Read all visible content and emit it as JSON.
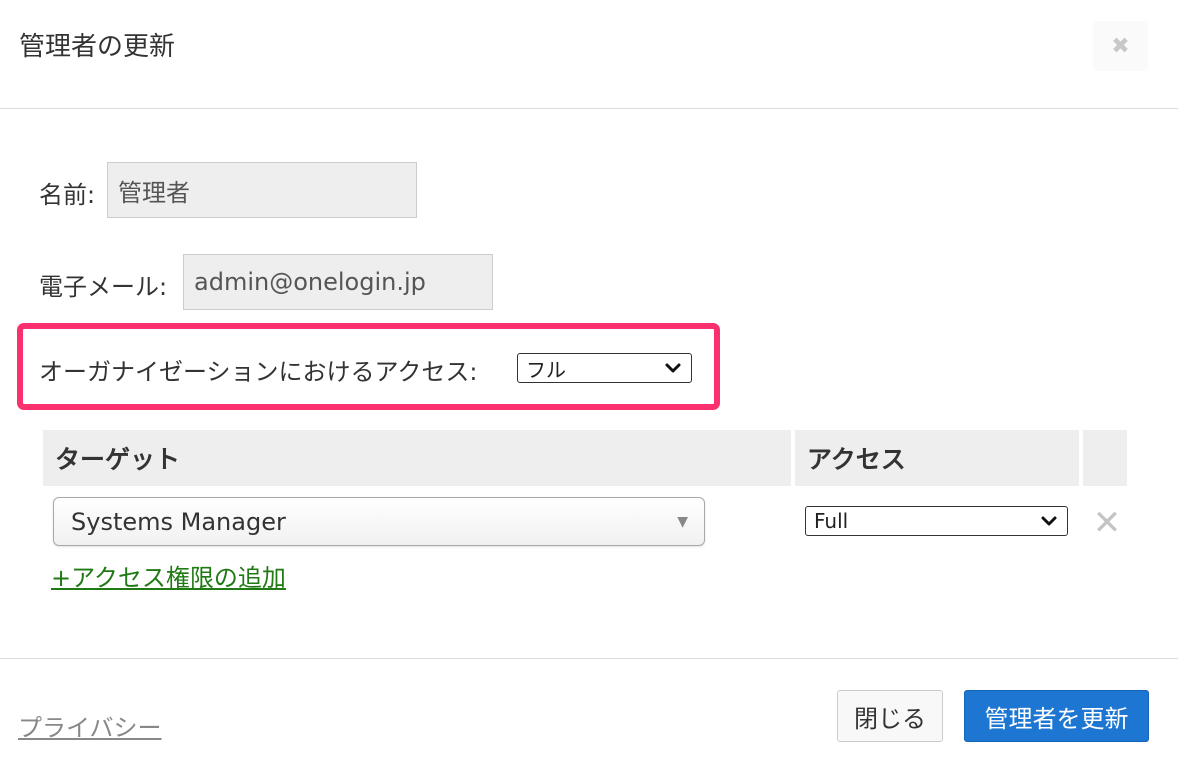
{
  "dialog": {
    "title": "管理者の更新",
    "close_icon": "close-icon"
  },
  "form": {
    "name_label": "名前:",
    "name_value": "管理者",
    "email_label": "電子メール:",
    "email_value": "admin@onelogin.jp",
    "org_access_label": "オーガナイゼーションにおけるアクセス:",
    "org_access_selected": "フル",
    "highlight_color": "#fb306f"
  },
  "access_table": {
    "columns": [
      "ターゲット",
      "アクセス"
    ],
    "rows": [
      {
        "target": "Systems Manager",
        "access": "Full"
      }
    ],
    "add_link": "+アクセス権限の追加"
  },
  "footer": {
    "privacy_link": "プライバシー",
    "close_button": "閉じる",
    "update_button": "管理者を更新",
    "primary_color": "#1c76d2",
    "link_color": "#207a14"
  }
}
